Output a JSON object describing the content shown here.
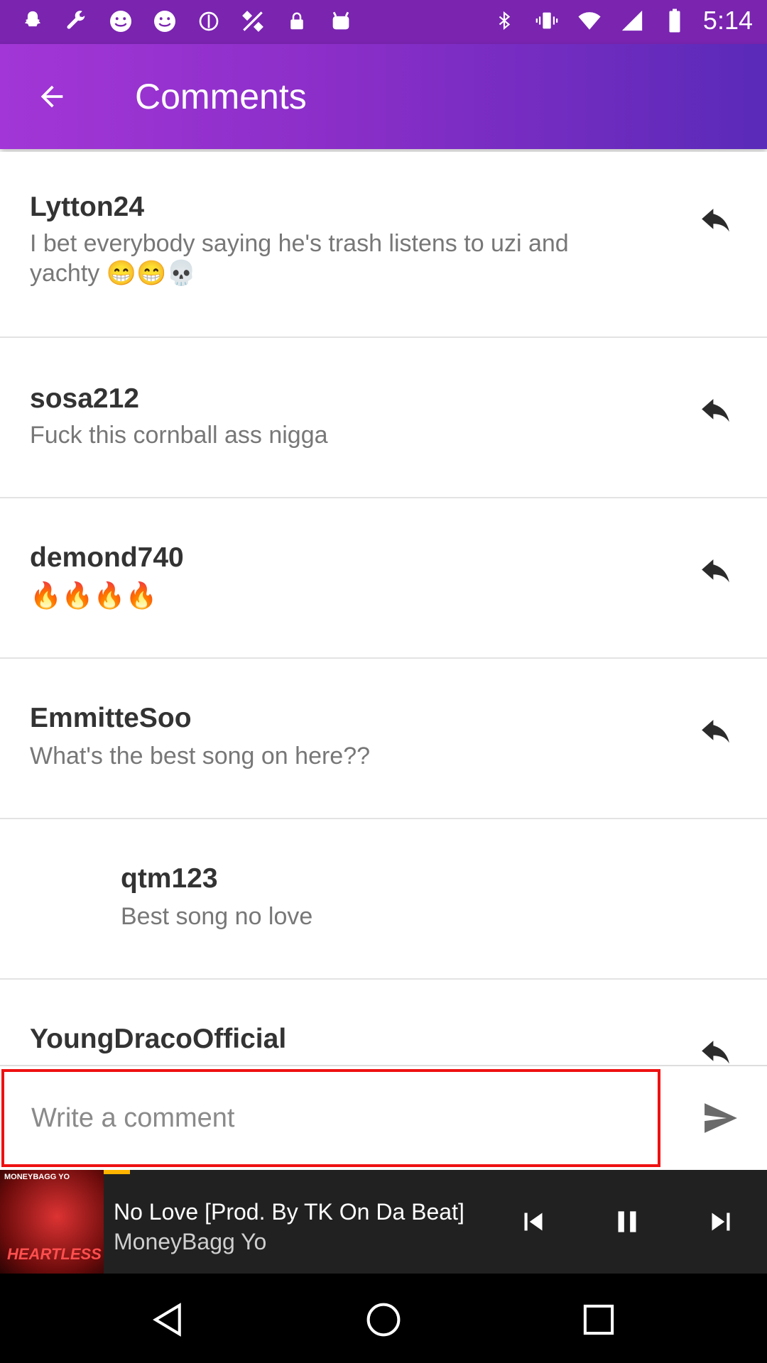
{
  "status_bar": {
    "time": "5:14",
    "left_icons": [
      "snapchat-icon",
      "wrench-icon",
      "smiley-icon",
      "smiley-icon",
      "cast-icon",
      "fake-gps-icon",
      "lock-icon",
      "android-icon"
    ],
    "right_icons": [
      "bluetooth-icon",
      "vibrate-icon",
      "wifi-icon",
      "signal-icon",
      "battery-icon"
    ]
  },
  "app_bar": {
    "title": "Comments"
  },
  "comments": [
    {
      "username": "Lytton24",
      "text": "I bet everybody saying he's trash listens to uzi and yachty 😁😁💀",
      "is_reply": false
    },
    {
      "username": "sosa212",
      "text": "Fuck this cornball ass nigga",
      "is_reply": false
    },
    {
      "username": "demond740",
      "text": "🔥🔥🔥🔥",
      "is_reply": false
    },
    {
      "username": "EmmitteSoo",
      "text": "What's the best song on here??",
      "is_reply": false
    },
    {
      "username": "qtm123",
      "text": "Best song no love",
      "is_reply": true
    },
    {
      "username": "YoungDracoOfficial",
      "text": "",
      "is_reply": false
    }
  ],
  "composer": {
    "placeholder": "Write a comment"
  },
  "player": {
    "cover_top_text": "MONEYBAGG YO",
    "cover_title": "HEARTLESS",
    "song_title": "No Love [Prod. By TK On Da Beat]",
    "artist": "MoneyBagg Yo",
    "progress_fraction": 0.04
  },
  "colors": {
    "accent": "#8a2ec8",
    "status_bar": "#7a24b0",
    "input_border": "#ee1111",
    "player_bg": "#212121",
    "progress": "#ffb400"
  }
}
